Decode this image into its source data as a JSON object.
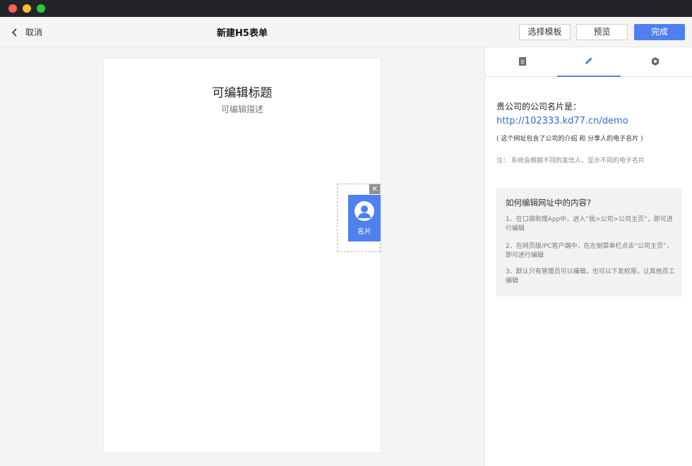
{
  "window": {
    "controls": [
      "close",
      "minimize",
      "maximize"
    ]
  },
  "header": {
    "back_label": "取消",
    "title": "新建H5表单",
    "buttons": {
      "select_template": "选择模板",
      "preview": "预览",
      "done": "完成"
    }
  },
  "form": {
    "title": "可编辑标题",
    "description": "可编辑描述",
    "widget": {
      "label": "名片",
      "close_glyph": "✕"
    }
  },
  "panel": {
    "tabs": [
      {
        "icon": "document-icon",
        "active": false
      },
      {
        "icon": "pencil-icon",
        "active": true
      },
      {
        "icon": "settings-icon",
        "active": false
      }
    ],
    "info": {
      "heading": "贵公司的公司名片是：",
      "link": "http://102333.kd77.cn/demo",
      "sub": "( 这个网址包含了公司的介绍 和 分享人的电子名片 )",
      "note": "注：  系统会根据不同的发信人，显示不同的电子名片"
    },
    "help": {
      "title": "如何编辑网址中的内容?",
      "items": [
        "1、在口袋助理App中，进入“我>公司>公司主页”，即可进行编辑",
        "2、在网页版/PC客户端中，在左侧菜单栏点击“公司主页”，即可进行编辑",
        "3、默认只有管理员可以编辑，也可以下发权限，让其他员工编辑"
      ]
    }
  },
  "colors": {
    "accent": "#4f80f0",
    "link": "#2f6ad9",
    "titlebar": "#23242a"
  }
}
